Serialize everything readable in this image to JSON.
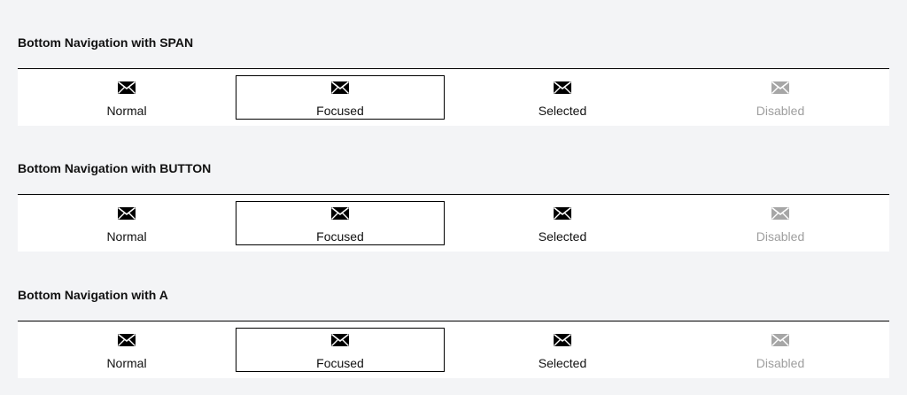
{
  "sections": [
    {
      "title": "Bottom Navigation with SPAN",
      "items": [
        {
          "label": "Normal",
          "icon": "mail-icon"
        },
        {
          "label": "Focused",
          "icon": "mail-icon"
        },
        {
          "label": "Selected",
          "icon": "mail-icon"
        },
        {
          "label": "Disabled",
          "icon": "mail-icon"
        }
      ]
    },
    {
      "title": "Bottom Navigation with BUTTON",
      "items": [
        {
          "label": "Normal",
          "icon": "mail-icon"
        },
        {
          "label": "Focused",
          "icon": "mail-icon"
        },
        {
          "label": "Selected",
          "icon": "mail-icon"
        },
        {
          "label": "Disabled",
          "icon": "mail-icon"
        }
      ]
    },
    {
      "title": "Bottom Navigation with A",
      "items": [
        {
          "label": "Normal",
          "icon": "mail-icon"
        },
        {
          "label": "Focused",
          "icon": "mail-icon"
        },
        {
          "label": "Selected",
          "icon": "mail-icon"
        },
        {
          "label": "Disabled",
          "icon": "mail-icon"
        }
      ]
    }
  ],
  "colors": {
    "background": "#f3f4f6",
    "nav_background": "#ffffff",
    "text": "#111111",
    "disabled_text": "#9e9e9e",
    "icon": "#000000",
    "disabled_icon": "#a6a6a6"
  }
}
